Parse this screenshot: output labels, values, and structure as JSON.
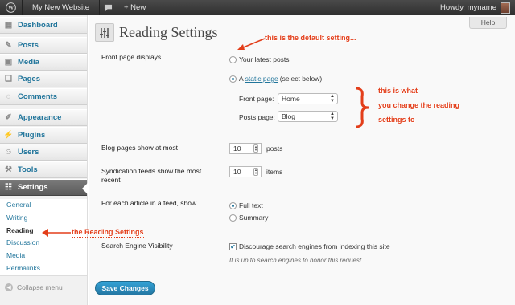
{
  "adminbar": {
    "site_name": "My New Website",
    "new_label": "+ New",
    "greeting": "Howdy, myname"
  },
  "sidebar": {
    "items": [
      {
        "label": "Dashboard",
        "icon": "dashboard-icon"
      },
      {
        "label": "Posts",
        "icon": "pushpin-icon"
      },
      {
        "label": "Media",
        "icon": "media-icon"
      },
      {
        "label": "Pages",
        "icon": "pages-icon"
      },
      {
        "label": "Comments",
        "icon": "comments-icon"
      },
      {
        "label": "Appearance",
        "icon": "brush-icon"
      },
      {
        "label": "Plugins",
        "icon": "plug-icon"
      },
      {
        "label": "Users",
        "icon": "users-icon"
      },
      {
        "label": "Tools",
        "icon": "tools-icon"
      },
      {
        "label": "Settings",
        "icon": "settings-icon"
      }
    ],
    "submenu": [
      "General",
      "Writing",
      "Reading",
      "Discussion",
      "Media",
      "Permalinks"
    ],
    "collapse_label": "Collapse menu"
  },
  "help_label": "Help",
  "page_title": "Reading Settings",
  "form": {
    "front_page_label": "Front page displays",
    "latest_posts_label": "Your latest posts",
    "static_prefix": "A",
    "static_link": "static page",
    "static_suffix": "(select below)",
    "front_page_select_label": "Front page:",
    "front_page_value": "Home",
    "posts_page_select_label": "Posts page:",
    "posts_page_value": "Blog",
    "blog_pages_label": "Blog pages show at most",
    "blog_pages_value": "10",
    "blog_pages_unit": "posts",
    "feeds_label": "Syndication feeds show the most recent",
    "feeds_value": "10",
    "feeds_unit": "items",
    "feed_show_label": "For each article in a feed, show",
    "full_text_label": "Full text",
    "summary_label": "Summary",
    "search_visibility_label": "Search Engine Visibility",
    "discourage_label": "Discourage search engines from indexing this site",
    "discourage_hint": "It is up to search engines to honor this request.",
    "save_label": "Save Changes"
  },
  "annotations": {
    "default_setting": "this is the default setting...",
    "change_line1": "this is what",
    "change_line2": "you change the reading",
    "change_line3": "settings to",
    "reading_settings": "the Reading Settings"
  },
  "colors": {
    "link": "#21759b",
    "annotation": "#e33e1a",
    "active_menu": "#6a6a6a",
    "save_button": "#2477a3"
  }
}
